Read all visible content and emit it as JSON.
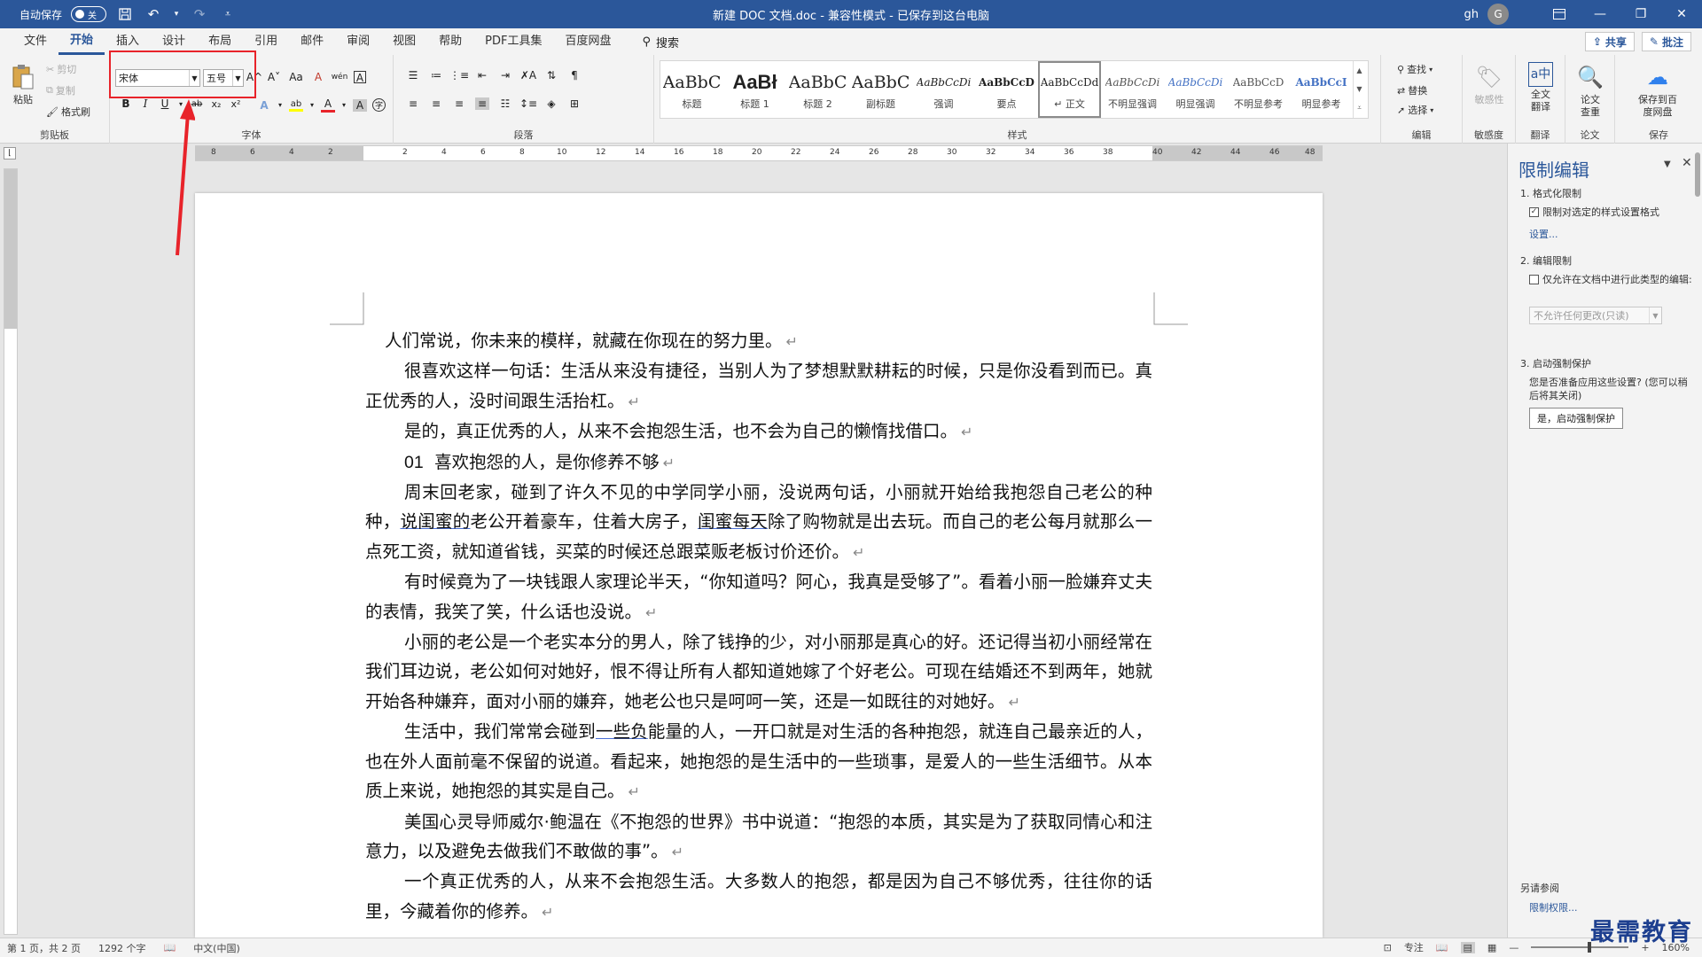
{
  "titlebar": {
    "autosave_label": "自动保存",
    "autosave_state": "关",
    "doc_title": "新建 DOC 文档.doc  -  兼容性模式  -  已保存到这台电脑",
    "user_name": "gh",
    "avatar_initial": "G"
  },
  "tabs": {
    "items": [
      "文件",
      "开始",
      "插入",
      "设计",
      "布局",
      "引用",
      "邮件",
      "审阅",
      "视图",
      "帮助",
      "PDF工具集",
      "百度网盘"
    ],
    "active": "开始",
    "search_label": "搜索",
    "share_label": "共享",
    "comment_label": "批注"
  },
  "ribbon": {
    "clipboard": {
      "label": "剪贴板",
      "paste": "粘贴",
      "cut": "剪切",
      "copy": "复制",
      "format_painter": "格式刷"
    },
    "font": {
      "label": "字体",
      "font_name": "宋体",
      "font_size": "五号",
      "bold": "B",
      "italic": "I",
      "underline": "U",
      "strike": "ab",
      "subscript": "x₂",
      "superscript": "x²",
      "grow": "A^",
      "shrink": "A˅",
      "case": "Aa",
      "clear": "A",
      "phonetic": "wén",
      "border": "A",
      "effects": "A",
      "highlight": "ab",
      "color": "A",
      "shading": "A",
      "enclose": "字"
    },
    "paragraph": {
      "label": "段落"
    },
    "styles": {
      "label": "样式",
      "items": [
        {
          "sample": "AaBbC",
          "name": "标题"
        },
        {
          "sample": "AaBł",
          "name": "标题 1"
        },
        {
          "sample": "AaBbC",
          "name": "标题 2"
        },
        {
          "sample": "AaBbC",
          "name": "副标题"
        },
        {
          "sample": "AaBbCcDi",
          "name": "强调"
        },
        {
          "sample": "AaBbCcD",
          "name": "要点"
        },
        {
          "sample": "AaBbCcDd",
          "name": "↵ 正文"
        },
        {
          "sample": "AaBbCcDi",
          "name": "不明显强调"
        },
        {
          "sample": "AaBbCcDi",
          "name": "明显强调"
        },
        {
          "sample": "AaBbCcD",
          "name": "不明显参考"
        },
        {
          "sample": "AaBbCcI",
          "name": "明显参考"
        }
      ],
      "selected": "↵ 正文"
    },
    "editing": {
      "label": "编辑",
      "find": "查找",
      "replace": "替换",
      "select": "选择"
    },
    "sensitivity": {
      "label": "敏感度",
      "button": "敏感性"
    },
    "translate": {
      "label": "翻译",
      "button": "全文翻译"
    },
    "paper": {
      "label": "论文",
      "button": "论文查重"
    },
    "save": {
      "label": "保存",
      "button": "保存到百度网盘"
    }
  },
  "ruler": {
    "marks": [
      "8",
      "6",
      "4",
      "2",
      "2",
      "4",
      "6",
      "8",
      "10",
      "12",
      "14",
      "16",
      "18",
      "20",
      "22",
      "24",
      "26",
      "28",
      "30",
      "32",
      "34",
      "36",
      "38",
      "40",
      "42",
      "44",
      "46",
      "48"
    ]
  },
  "document": {
    "p1": "人们常说，你未来的模样，就藏在你现在的努力里。",
    "p2": "很喜欢这样一句话：生活从来没有捷径，当别人为了梦想默默耕耘的时候，只是你没看到而已。真正优秀的人，没时间跟生活抬杠。",
    "p3": "是的，真正优秀的人，从来不会抱怨生活，也不会为自己的懒惰找借口。",
    "p4_num": "01",
    "p4_text": "喜欢抱怨的人，是你修养不够",
    "p5a": "周末回老家，碰到了许久不见的中学同学小丽，没说两句话，小丽就开始给我抱怨自己老公的种种，",
    "p5b": "说闺蜜的",
    "p5c": "老公开着豪车，住着大房子，",
    "p5d": "闺蜜每天",
    "p5e": "除了购物就是出去玩。而自己的老公每月就那么一点死工资，就知道省钱，买菜的时候还总跟菜贩老板讨价还价。",
    "p6": "有时候竟为了一块钱跟人家理论半天，“你知道吗？阿心，我真是受够了”。看着小丽一脸嫌弃丈夫的表情，我笑了笑，什么话也没说。",
    "p7": "小丽的老公是一个老实本分的男人，除了钱挣的少，对小丽那是真心的好。还记得当初小丽经常在我们耳边说，老公如何对她好，恨不得让所有人都知道她嫁了个好老公。可现在结婚还不到两年，她就开始各种嫌弃，面对小丽的嫌弃，她老公也只是呵呵一笑，还是一如既往的对她好。",
    "p8a": "生活中，我们常常会碰到",
    "p8b": "一些负",
    "p8c": "能量的人，一开口就是对生活的各种抱怨，就连自己最亲近的人，也在外人面前毫不保留的说道。看起来，她抱怨的是生活中的一些琐事，是爱人的一些生活细节。从本质上来说，她抱怨的其实是自己。",
    "p9": "美国心灵导师威尔·鲍温在《不抱怨的世界》书中说道：“抱怨的本质，其实是为了获取同情心和注意力，以及避免去做我们不敢做的事”。",
    "p10": "一个真正优秀的人，从来不会抱怨生活。大多数人的抱怨，都是因为自己不够优秀，往往你的话里，今藏着你的修养。",
    "para_mark": "↵"
  },
  "pane": {
    "title": "限制编辑",
    "s1": "1. 格式化限制",
    "s1_check": "限制对选定的样式设置格式",
    "s1_link": "设置...",
    "s2": "2. 编辑限制",
    "s2_check": "仅允许在文档中进行此类型的编辑:",
    "s2_select": "不允许任何更改(只读)",
    "s3": "3. 启动强制保护",
    "s3_text": "您是否准备应用这些设置? (您可以稍后将其关闭)",
    "s3_button": "是，启动强制保护",
    "see_also": "另请参阅",
    "permissions_link": "限制权限..."
  },
  "statusbar": {
    "page": "第 1 页，共 2 页",
    "words": "1292 个字",
    "language": "中文(中国)",
    "focus": "专注",
    "zoom": "160%"
  },
  "watermark": "最需教育"
}
